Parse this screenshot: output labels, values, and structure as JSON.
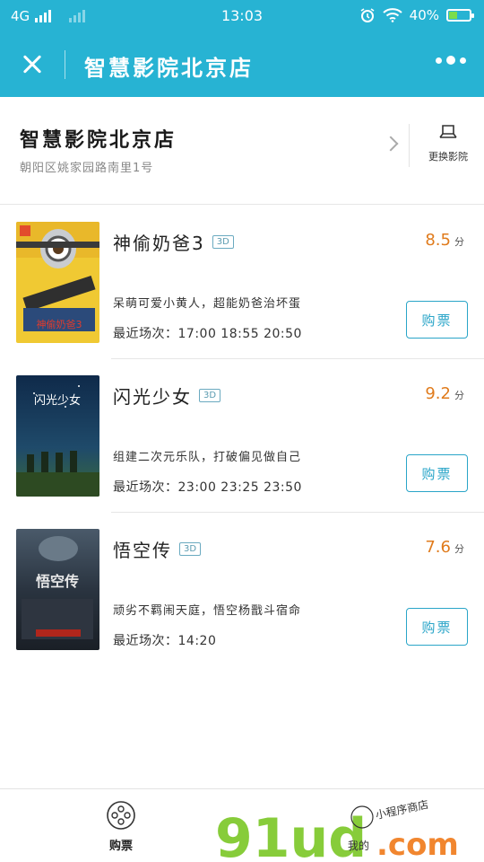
{
  "status_bar": {
    "network": "4G",
    "time": "13:03",
    "battery": "40%",
    "battery_level": 0.4
  },
  "header": {
    "title": "智慧影院北京店",
    "close_icon": "close-icon",
    "more_icon": "more-dots-icon",
    "accent_color": "#27b3d3"
  },
  "cinema": {
    "name": "智慧影院北京店",
    "address": "朝阳区姚家园路南里1号",
    "change_label": "更换影院"
  },
  "movies": [
    {
      "title": "神偷奶爸3",
      "format": "3D",
      "rating": "8.5",
      "rating_unit": "分",
      "desc": "呆萌可爱小黄人，超能奶爸治坏蛋",
      "showtimes": "最近场次：17:00 18:55 20:50",
      "buy_label": "购票"
    },
    {
      "title": "闪光少女",
      "format": "3D",
      "rating": "9.2",
      "rating_unit": "分",
      "desc": "组建二次元乐队，打破偏见做自己",
      "showtimes": "最近场次：23:00 23:25 23:50",
      "buy_label": "购票"
    },
    {
      "title": "悟空传",
      "format": "3D",
      "rating": "7.6",
      "rating_unit": "分",
      "desc": "顽劣不羁闹天庭，悟空杨戬斗宿命",
      "showtimes": "最近场次：14:20",
      "buy_label": "购票"
    }
  ],
  "posters": [
    {
      "caption": "神偷奶爸3",
      "corner_mark": ""
    },
    {
      "caption": "闪光少女"
    },
    {
      "caption": "悟空传"
    }
  ],
  "tabbar": {
    "buy_label": "购票"
  },
  "watermark": {
    "logo_text": "91ud.com",
    "sub_text": "小程序商店",
    "extra_text": "我的"
  }
}
